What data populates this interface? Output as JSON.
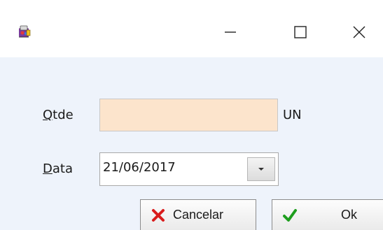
{
  "window": {
    "app_icon": "app-icon",
    "controls": {
      "minimize_glyph": "—",
      "maximize_glyph": "☐",
      "close_glyph": "✕"
    }
  },
  "form": {
    "qtde": {
      "label_accel": "Q",
      "label_rest": "tde",
      "value": "",
      "placeholder": "",
      "unit": "UN",
      "bg_color": "#fce4cc"
    },
    "data": {
      "label_accel": "D",
      "label_rest": "ata",
      "value": "21/06/2017",
      "dropdown_icon": "chevron-down-icon"
    }
  },
  "buttons": {
    "cancel": {
      "label": "Cancelar",
      "icon": "cancel-x-icon",
      "icon_color": "#d91c1c"
    },
    "ok": {
      "label": "Ok",
      "icon": "checkmark-icon",
      "icon_color": "#1e9e1e"
    }
  },
  "colors": {
    "client_bg": "#eef3fb",
    "titlebar_bg": "#ffffff"
  }
}
